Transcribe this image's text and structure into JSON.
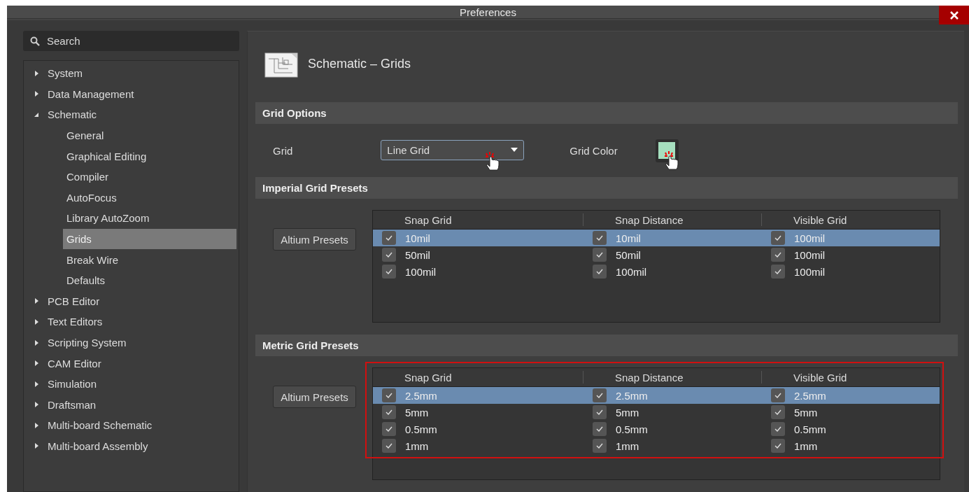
{
  "window": {
    "title": "Preferences"
  },
  "sidebar": {
    "search": {
      "placeholder": "Search"
    },
    "tree": [
      {
        "label": "System",
        "expanded": false,
        "selected": false
      },
      {
        "label": "Data Management",
        "expanded": false,
        "selected": false
      },
      {
        "label": "Schematic",
        "expanded": true,
        "selected": false,
        "children": [
          {
            "label": "General",
            "selected": false
          },
          {
            "label": "Graphical Editing",
            "selected": false
          },
          {
            "label": "Compiler",
            "selected": false
          },
          {
            "label": "AutoFocus",
            "selected": false
          },
          {
            "label": "Library AutoZoom",
            "selected": false
          },
          {
            "label": "Grids",
            "selected": true
          },
          {
            "label": "Break Wire",
            "selected": false
          },
          {
            "label": "Defaults",
            "selected": false
          }
        ]
      },
      {
        "label": "PCB Editor",
        "expanded": false,
        "selected": false
      },
      {
        "label": "Text Editors",
        "expanded": false,
        "selected": false
      },
      {
        "label": "Scripting System",
        "expanded": false,
        "selected": false
      },
      {
        "label": "CAM Editor",
        "expanded": false,
        "selected": false
      },
      {
        "label": "Simulation",
        "expanded": false,
        "selected": false
      },
      {
        "label": "Draftsman",
        "expanded": false,
        "selected": false
      },
      {
        "label": "Multi-board Schematic",
        "expanded": false,
        "selected": false
      },
      {
        "label": "Multi-board Assembly",
        "expanded": false,
        "selected": false
      }
    ]
  },
  "page": {
    "title": "Schematic – Grids",
    "sections": [
      {
        "kind": "options",
        "title": "Grid Options",
        "grid": {
          "label": "Grid",
          "value": "Line Grid"
        },
        "grid_color": {
          "label": "Grid Color",
          "color": "#a6dfbf"
        }
      },
      {
        "kind": "presets",
        "title": "Imperial Grid Presets",
        "button": "Altium Presets",
        "highlighted": false,
        "columns": [
          "Snap Grid",
          "Snap Distance",
          "Visible Grid"
        ],
        "rows": [
          {
            "selected": true,
            "cells": [
              {
                "value": "10mil",
                "checked": true
              },
              {
                "value": "10mil",
                "checked": true
              },
              {
                "value": "100mil",
                "checked": true
              }
            ]
          },
          {
            "selected": false,
            "cells": [
              {
                "value": "50mil",
                "checked": true
              },
              {
                "value": "50mil",
                "checked": true
              },
              {
                "value": "100mil",
                "checked": true
              }
            ]
          },
          {
            "selected": false,
            "cells": [
              {
                "value": "100mil",
                "checked": true
              },
              {
                "value": "100mil",
                "checked": true
              },
              {
                "value": "100mil",
                "checked": true
              }
            ]
          }
        ]
      },
      {
        "kind": "presets",
        "title": "Metric Grid Presets",
        "button": "Altium Presets",
        "highlighted": true,
        "columns": [
          "Snap Grid",
          "Snap Distance",
          "Visible Grid"
        ],
        "rows": [
          {
            "selected": true,
            "cells": [
              {
                "value": "2.5mm",
                "checked": true
              },
              {
                "value": "2.5mm",
                "checked": true
              },
              {
                "value": "2.5mm",
                "checked": true
              }
            ]
          },
          {
            "selected": false,
            "cells": [
              {
                "value": "5mm",
                "checked": true
              },
              {
                "value": "5mm",
                "checked": true
              },
              {
                "value": "5mm",
                "checked": true
              }
            ]
          },
          {
            "selected": false,
            "cells": [
              {
                "value": "0.5mm",
                "checked": true
              },
              {
                "value": "0.5mm",
                "checked": true
              },
              {
                "value": "0.5mm",
                "checked": true
              }
            ]
          },
          {
            "selected": false,
            "cells": [
              {
                "value": "1mm",
                "checked": true
              },
              {
                "value": "1mm",
                "checked": true
              },
              {
                "value": "1mm",
                "checked": true
              }
            ]
          }
        ]
      }
    ]
  }
}
